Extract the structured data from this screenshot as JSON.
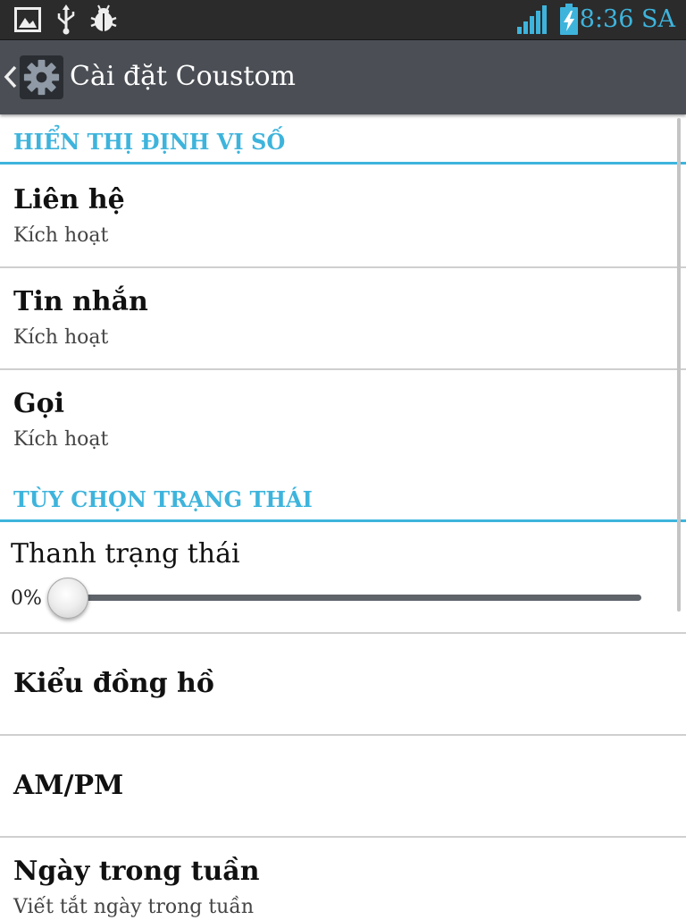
{
  "status_bar": {
    "time": "8:36 SA",
    "icons": [
      "image-icon",
      "usb-icon",
      "debug-icon",
      "signal-icon",
      "battery-charging-icon"
    ],
    "accent_color": "#3eb4dc"
  },
  "action_bar": {
    "title": "Cài đặt Coustom",
    "icons": [
      "back-chevron-icon",
      "settings-gear-icon"
    ]
  },
  "sections": [
    {
      "header": "HIỂN THỊ ĐỊNH VỊ SỐ",
      "items": [
        {
          "title": "Liên hệ",
          "summary": "Kích hoạt"
        },
        {
          "title": "Tin nhắn",
          "summary": "Kích hoạt"
        },
        {
          "title": "Gọi",
          "summary": "Kích hoạt"
        }
      ]
    },
    {
      "header": "TÙY CHỌN TRẠNG THÁI",
      "slider": {
        "title": "Thanh trạng thái",
        "value_label": "0%",
        "value": 0
      },
      "items": [
        {
          "title": "Kiểu đồng hồ"
        },
        {
          "title": "AM/PM"
        },
        {
          "title": "Ngày trong tuần",
          "summary": "Viết tắt ngày trong tuần"
        }
      ]
    }
  ],
  "colors": {
    "accent": "#3eb4dc",
    "action_bar": "#4b4f55",
    "status_bar": "#2b2b2b",
    "divider": "#cfcfcf"
  }
}
